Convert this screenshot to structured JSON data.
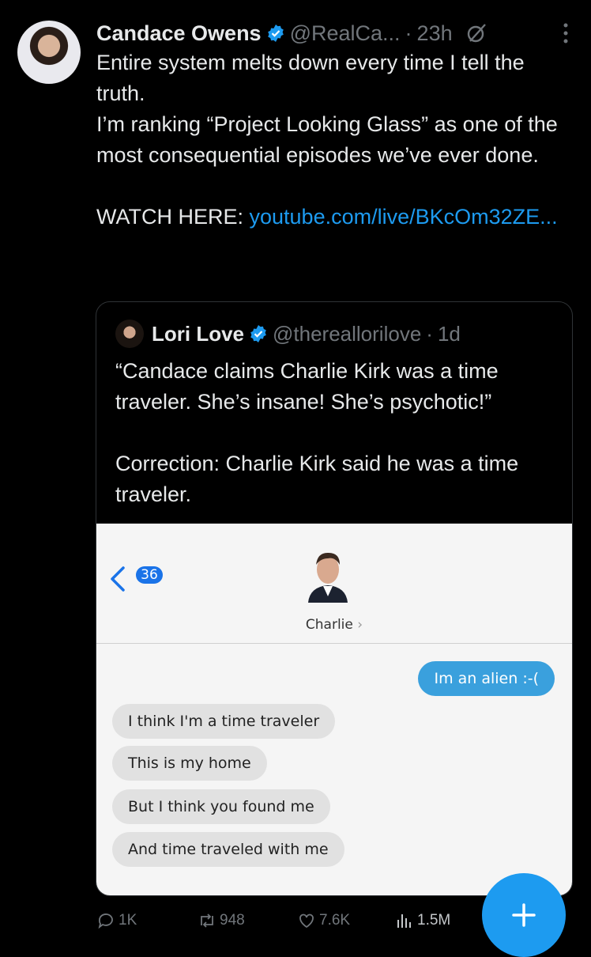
{
  "post": {
    "author": "Candace Owens",
    "handle": "@RealCa...",
    "time": "23h",
    "text_lines": [
      "Entire system melts down every time I tell the truth.",
      "I’m ranking “Project Looking Glass” as one of the most consequential episodes we’ve ever done."
    ],
    "watch_prefix": "WATCH HERE: ",
    "link_text": "youtube.com/live/BKcOm32ZE..."
  },
  "quote": {
    "author": "Lori Love",
    "handle": "@thereallorilove",
    "time": "1d",
    "text_lines": [
      "“Candace claims Charlie Kirk was a time traveler. She’s insane! She’s psychotic!”",
      "Correction: Charlie Kirk said he was a time traveler."
    ],
    "screenshot": {
      "unread_count": "36",
      "contact_name": "Charlie",
      "sent_message": "Im an alien :-(",
      "received_messages": [
        "I think I'm a time traveler",
        "This is my home",
        "But I think you found me",
        "And time traveled with me"
      ]
    }
  },
  "actions": {
    "replies": "1K",
    "reposts": "948",
    "likes": "7.6K",
    "views": "1.5M"
  },
  "colors": {
    "accent": "#1d9bf0",
    "background": "#000000",
    "muted": "#71767b"
  }
}
